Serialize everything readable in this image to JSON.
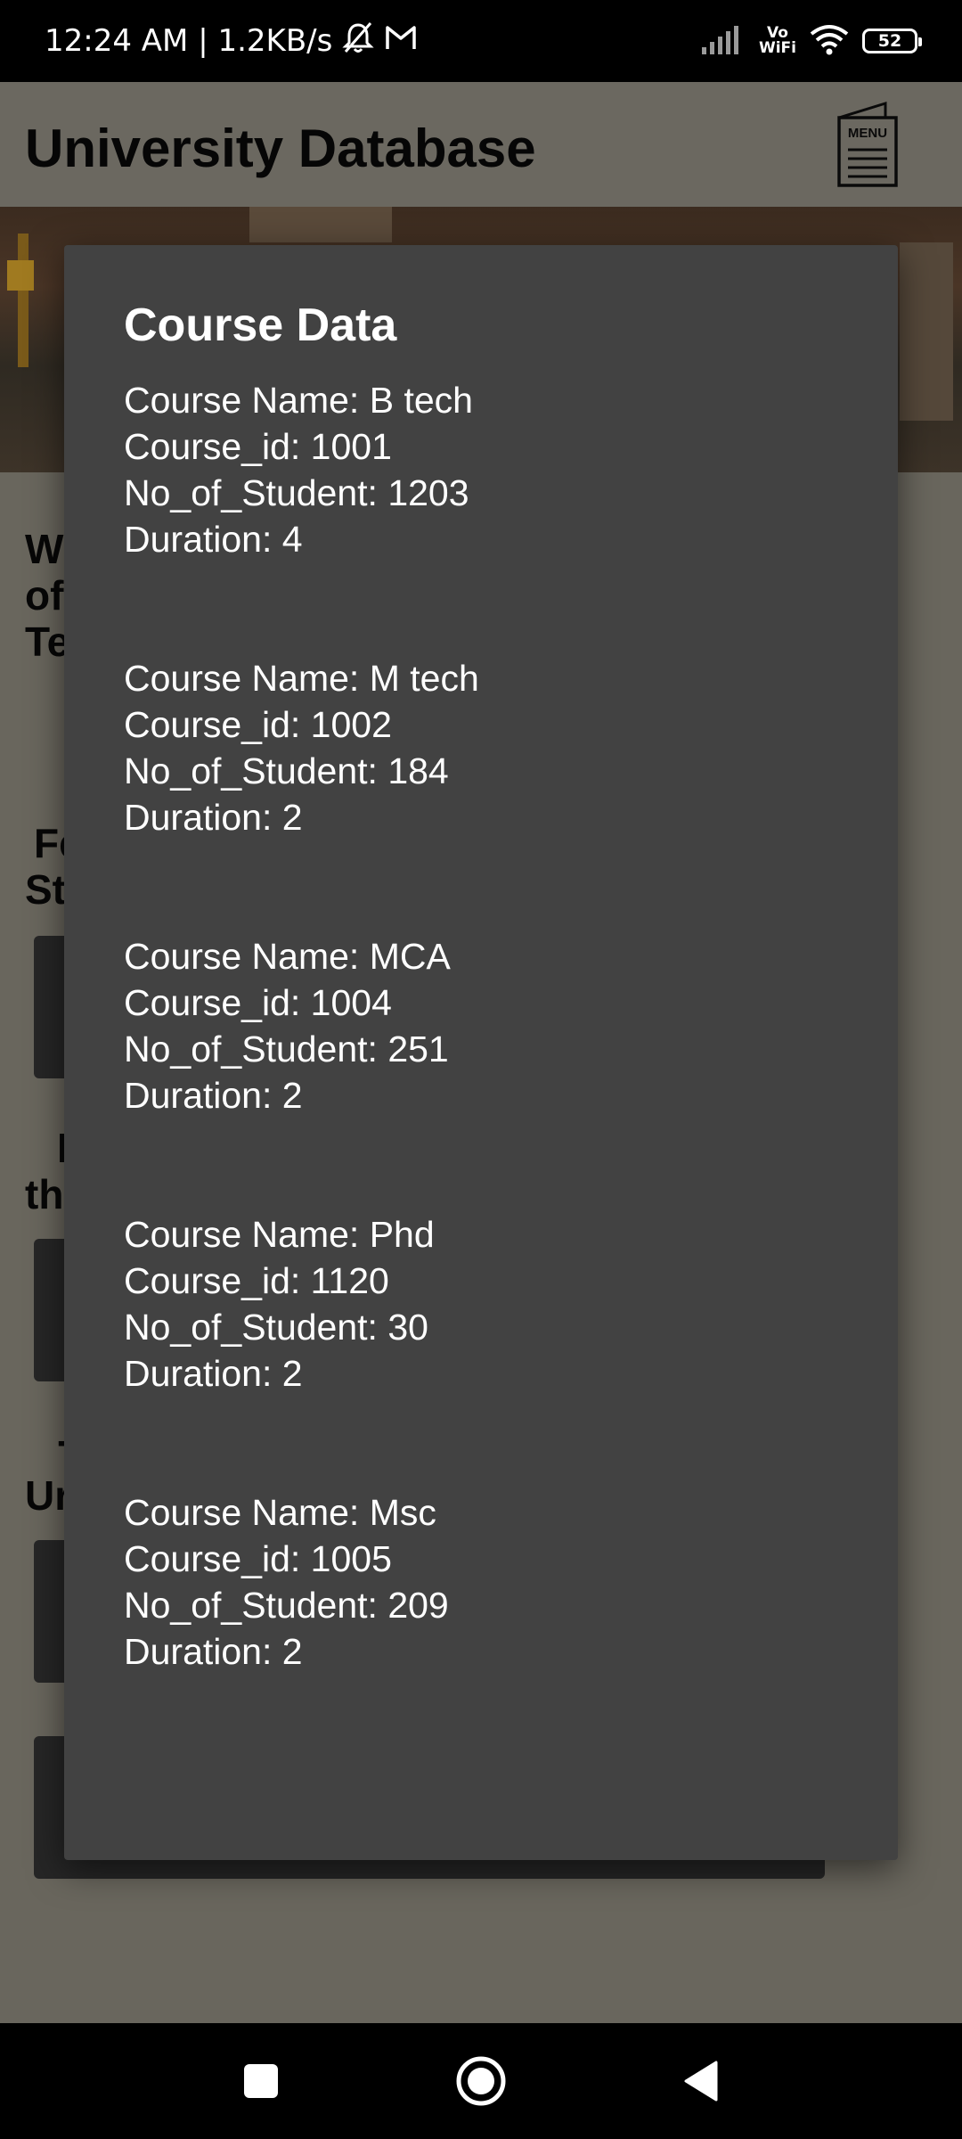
{
  "status_bar": {
    "time_speed": "12:24 AM | 1.2KB/s",
    "vowifi_top": "Vo",
    "vowifi_bottom": "WiFi",
    "battery": "52",
    "icons": [
      "silent-bell-icon",
      "gmail-icon",
      "signal-icon",
      "wifi-icon",
      "battery-icon"
    ]
  },
  "app": {
    "title": "University Database",
    "menu_icon_label": "MENU",
    "background_fragments": [
      "We",
      "of",
      "Te",
      "Fe",
      "St",
      "I",
      "th",
      "-",
      "Ur"
    ]
  },
  "dialog": {
    "title": "Course Data",
    "courses": [
      {
        "name": "Course Name: B tech",
        "id": "Course_id: 1001",
        "students": "No_of_Student: 1203",
        "duration": "Duration: 4"
      },
      {
        "name": "Course Name: M tech",
        "id": "Course_id: 1002",
        "students": "No_of_Student: 184",
        "duration": "Duration: 2"
      },
      {
        "name": "Course Name: MCA",
        "id": "Course_id: 1004",
        "students": "No_of_Student: 251",
        "duration": "Duration: 2"
      },
      {
        "name": "Course Name: Phd",
        "id": "Course_id: 1120",
        "students": "No_of_Student: 30",
        "duration": "Duration: 2"
      },
      {
        "name": "Course Name: Msc",
        "id": "Course_id: 1005",
        "students": "No_of_Student: 209",
        "duration": "Duration: 2"
      }
    ]
  },
  "nav_bar": {
    "icons": [
      "recents-square-icon",
      "home-circle-icon",
      "back-triangle-icon"
    ]
  },
  "colors": {
    "dialog_background": "#424242",
    "scrim_background": "#69665d",
    "status_bar": "#000000",
    "text_on_dialog": "#ffffff"
  }
}
